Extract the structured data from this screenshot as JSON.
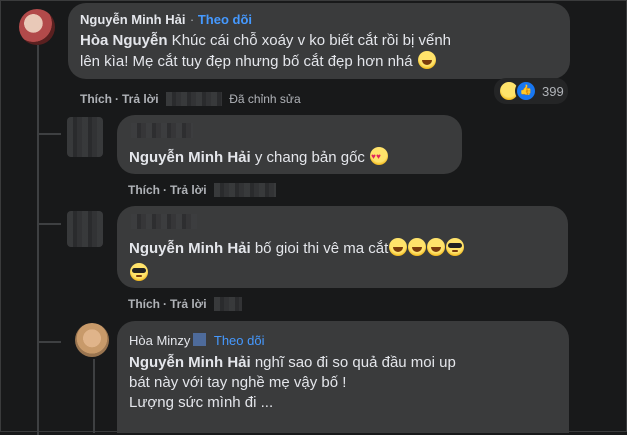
{
  "colors": {
    "background": "#18191a",
    "bubble": "#3a3b3c",
    "follow": "#4599ff",
    "meta": "#b0b3b8"
  },
  "comment_main": {
    "author": "Nguyễn Minh Hải",
    "follow": "Theo dõi",
    "mention": "Hòa Nguyễn",
    "text_line1": " Khúc cái chỗ xoáy v ko biết cắt rồi bị vểnh",
    "text_line2": "lên kìa! Mẹ cắt tuy đẹp nhưng bố cắt đẹp hơn nhá",
    "emoji": "laughing-emoji",
    "actions": {
      "like": "Thích",
      "reply": "Trả lời",
      "edited": "Đã chỉnh sửa"
    },
    "reactions": {
      "icons": [
        "haha",
        "like"
      ],
      "count": "399"
    }
  },
  "reply_1": {
    "mention": "Nguyễn Minh Hải",
    "text": " y chang bản gốc",
    "emoji": "heart-eyes-emoji",
    "actions": {
      "like": "Thích",
      "reply": "Trả lời"
    }
  },
  "reply_2": {
    "mention": "Nguyễn Minh Hải",
    "text": " bố gioi thi vê ma cắt",
    "emojis": [
      "laugh",
      "laugh",
      "laugh",
      "cool",
      "cool"
    ],
    "actions": {
      "like": "Thích",
      "reply": "Trả lời"
    }
  },
  "reply_3": {
    "author": "Hòa Minzy",
    "follow": "Theo dõi",
    "mention": "Nguyễn Minh Hải",
    "text_line1": " nghĩ sao đi so quả đầu moi up",
    "text_line2": "bát này với tay nghề mẹ vậy bố !",
    "text_line3": "Lượng sức mình đi ..."
  }
}
